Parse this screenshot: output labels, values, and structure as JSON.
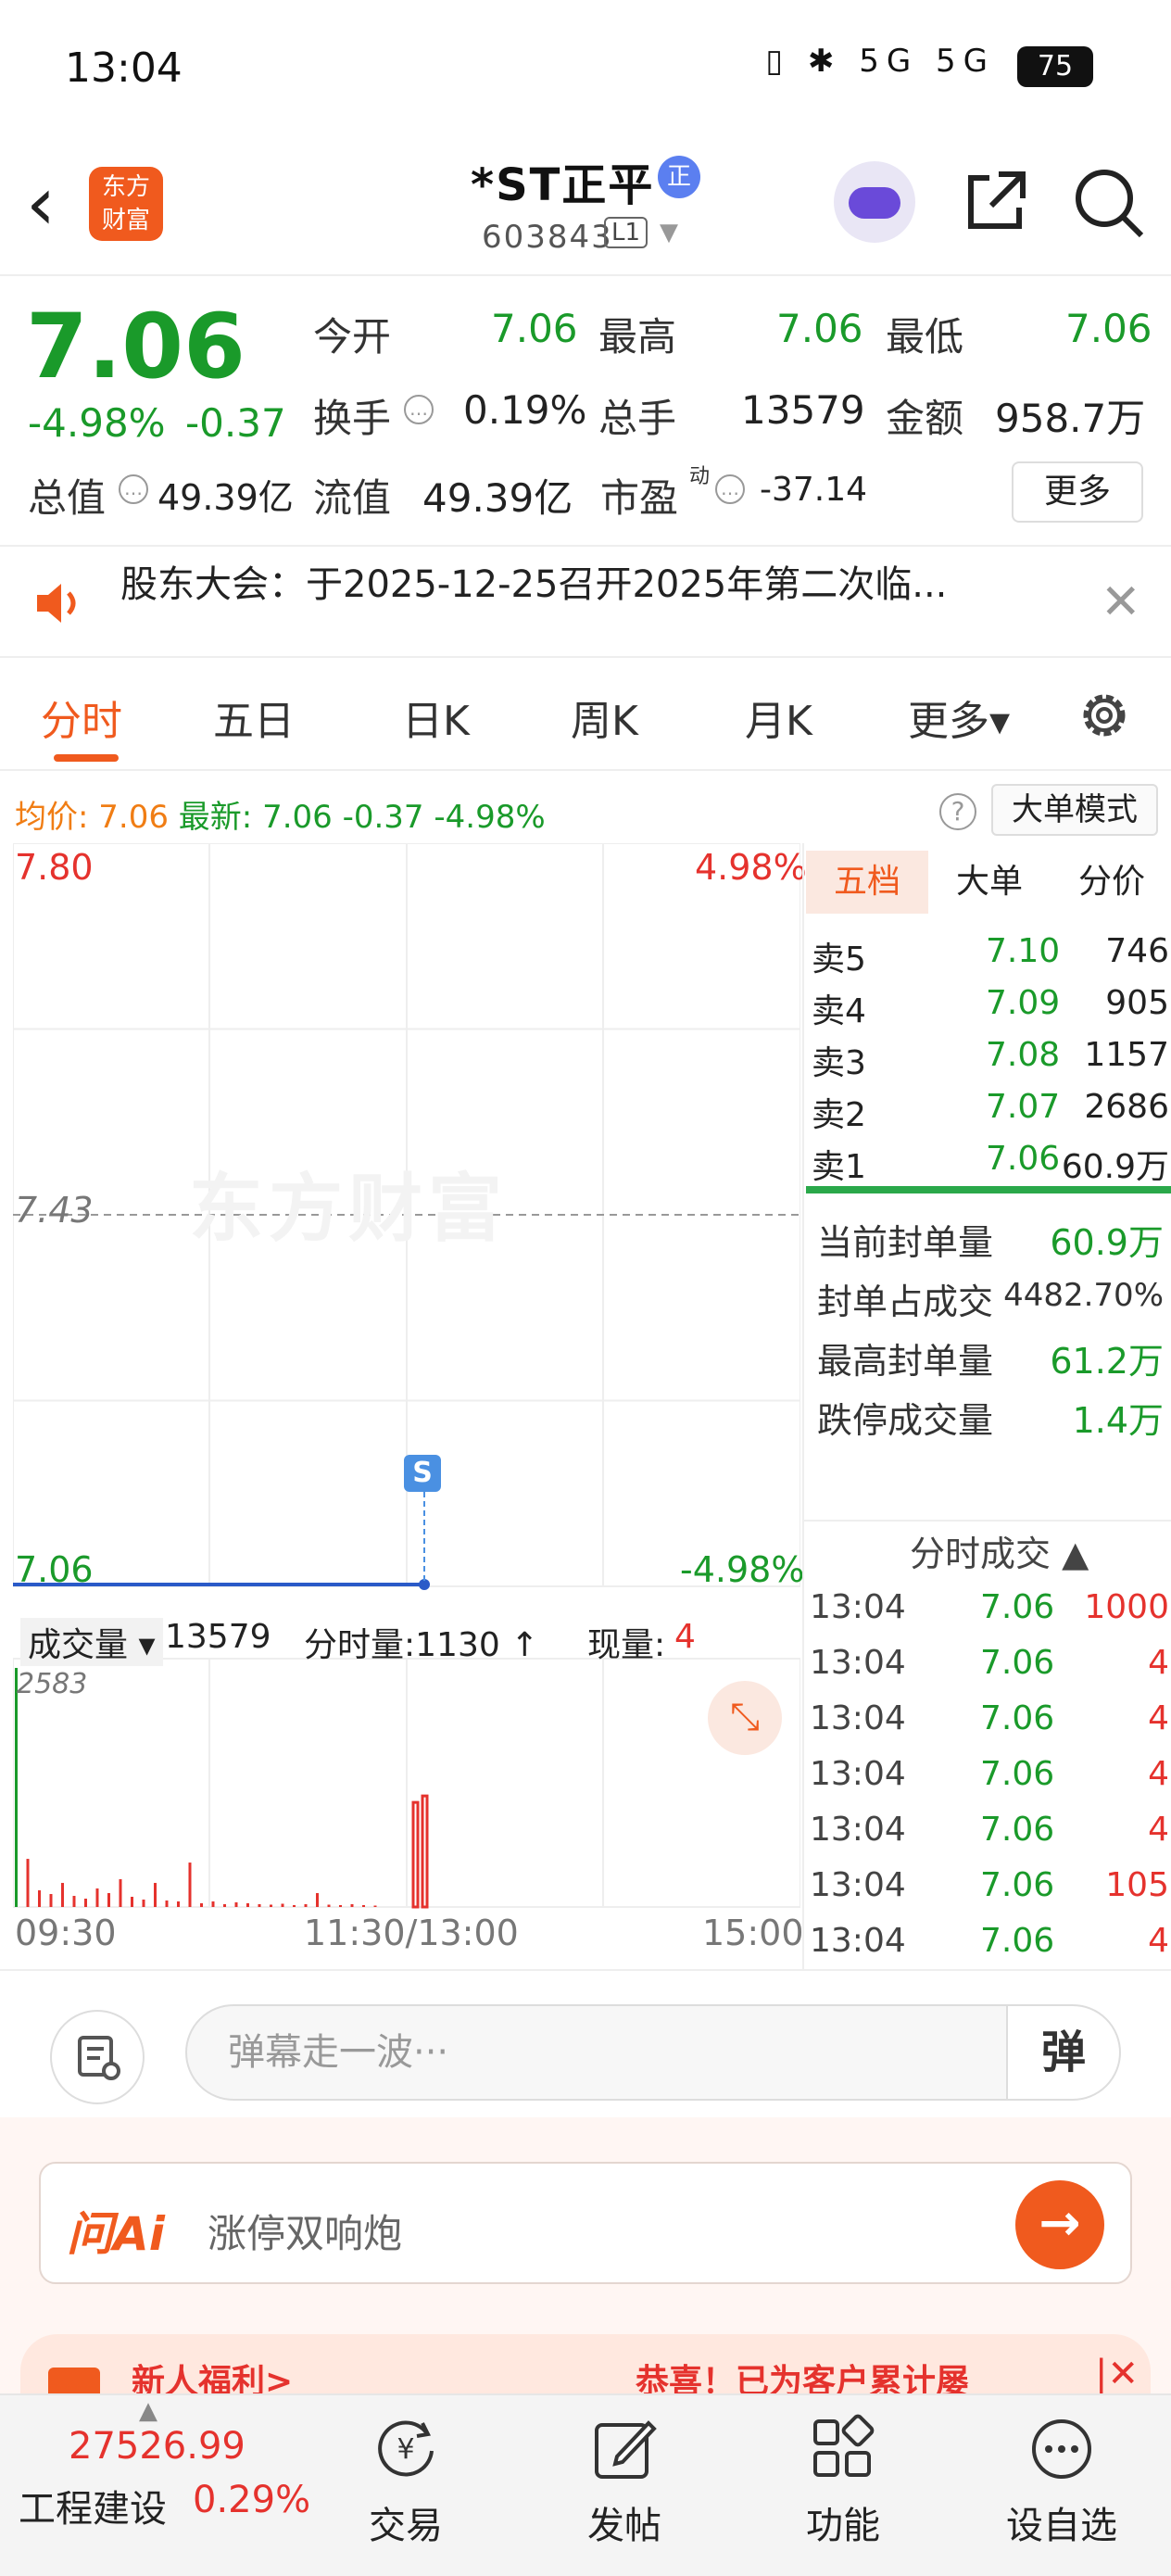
{
  "status_bar": {
    "time": "13:04",
    "icons_text": "▯ ✱ 5G 5G",
    "battery": "75"
  },
  "header": {
    "logo_line1": "东方",
    "logo_line2": "财富",
    "stock_name": "*ST正平",
    "name_badge": "正",
    "stock_code": "603843",
    "level_badge": "L1"
  },
  "quote": {
    "price": "7.06",
    "change_pct": "-4.98%",
    "change_val": "-0.37",
    "open_label": "今开",
    "open_value": "7.06",
    "high_label": "最高",
    "high_value": "7.06",
    "low_label": "最低",
    "low_value": "7.06",
    "turnover_label": "换手",
    "turnover_value": "0.19%",
    "volume_label": "总手",
    "volume_value": "13579",
    "amount_label": "金额",
    "amount_value": "958.7万",
    "mktcap_label": "总值",
    "mktcap_value": "49.39亿",
    "float_label": "流值",
    "float_value": "49.39亿",
    "pe_label": "市盈",
    "pe_sup": "动",
    "pe_value": "-37.14",
    "more_label": "更多"
  },
  "notice": {
    "text": "股东大会：于2025-12-25召开2025年第二次临..."
  },
  "tabs": [
    {
      "label": "分时"
    },
    {
      "label": "五日"
    },
    {
      "label": "日K"
    },
    {
      "label": "周K"
    },
    {
      "label": "月K"
    },
    {
      "label": "更多▾"
    }
  ],
  "info": {
    "avg_label": "均价:",
    "avg_value": "7.06",
    "latest_label": "最新:",
    "latest_value": "7.06",
    "latest_chg": "-0.37",
    "latest_pct": "-4.98%",
    "mode_button": "大单模式"
  },
  "chart": {
    "watermark": "东方财富",
    "y_top": "7.80",
    "y_top_pct": "4.98%",
    "y_mid": "7.43",
    "y_bottom": "7.06",
    "y_bottom_pct": "-4.98%",
    "s_marker": "S",
    "volume_label": "成交量",
    "volume_total": "13579",
    "minute_volume": "分时量:1130 ↑",
    "current_label": "现量:",
    "current_value": "4",
    "volume_axis_max": "2583",
    "time_start": "09:30",
    "time_mid": "11:30/13:00",
    "time_end": "15:00"
  },
  "chart_data": {
    "type": "line",
    "title": "",
    "price_range": [
      7.06,
      7.8
    ],
    "reference_price": 7.43,
    "line_color": "#2a5ac8",
    "volume_max": 2583,
    "volume_bars": [
      2583,
      520,
      180,
      140,
      260,
      120,
      90,
      200,
      150,
      300,
      110,
      80,
      260,
      70,
      60,
      480,
      40,
      60,
      30,
      50,
      40,
      30,
      25,
      35,
      20,
      30,
      150,
      25,
      20,
      30,
      20,
      15,
      1130,
      1200
    ],
    "up_color": "#e5322d",
    "down_color": "#1a9a2a"
  },
  "order_book": {
    "tabs": [
      "五档",
      "大单",
      "分价"
    ],
    "asks": [
      {
        "label": "卖5",
        "price": "7.10",
        "volume": "746"
      },
      {
        "label": "卖4",
        "price": "7.09",
        "volume": "905"
      },
      {
        "label": "卖3",
        "price": "7.08",
        "volume": "1157"
      },
      {
        "label": "卖2",
        "price": "7.07",
        "volume": "2686"
      },
      {
        "label": "卖1",
        "price": "7.06",
        "volume": "60.9万"
      }
    ],
    "seal": [
      {
        "label": "当前封单量",
        "value": "60.9万"
      },
      {
        "label": "封单占成交",
        "value": "4482.70%"
      },
      {
        "label": "最高封单量",
        "value": "61.2万"
      },
      {
        "label": "跌停成交量",
        "value": "1.4万"
      }
    ],
    "trades_header": "分时成交 ▲",
    "trades": [
      {
        "time": "13:04",
        "price": "7.06",
        "volume": "1000"
      },
      {
        "time": "13:04",
        "price": "7.06",
        "volume": "4"
      },
      {
        "time": "13:04",
        "price": "7.06",
        "volume": "4"
      },
      {
        "time": "13:04",
        "price": "7.06",
        "volume": "4"
      },
      {
        "time": "13:04",
        "price": "7.06",
        "volume": "4"
      },
      {
        "time": "13:04",
        "price": "7.06",
        "volume": "105"
      },
      {
        "time": "13:04",
        "price": "7.06",
        "volume": "4"
      }
    ]
  },
  "comment": {
    "placeholder": "弹幕走一波···",
    "danmu_button": "弹"
  },
  "ai": {
    "logo": "问Ai",
    "prompt": "涨停双响炮"
  },
  "promo": {
    "left_text": "新人福利>",
    "right_text": "恭喜！已为客户累计屡",
    "close": "|✕"
  },
  "nav": {
    "index_value": "27526.99",
    "index_name": "工程建设",
    "index_pct": "0.29%",
    "items": [
      {
        "label": "交易"
      },
      {
        "label": "发帖"
      },
      {
        "label": "功能"
      },
      {
        "label": "设自选"
      }
    ]
  }
}
